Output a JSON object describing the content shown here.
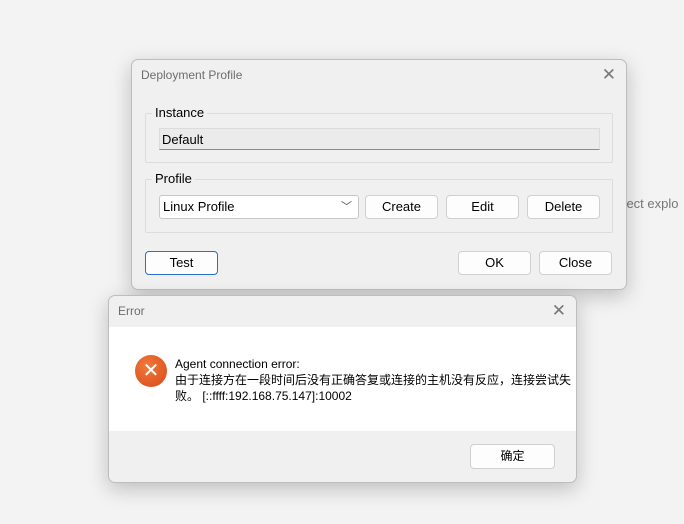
{
  "background": {
    "text": "roject explo"
  },
  "deployment_dialog": {
    "title": "Deployment Profile",
    "instance_label": "Instance",
    "instance_value": "Default",
    "profile_label": "Profile",
    "profile_selected": "Linux Profile",
    "create": "Create",
    "edit": "Edit",
    "delete": "Delete",
    "test": "Test",
    "ok": "OK",
    "close": "Close"
  },
  "error_dialog": {
    "title": "Error",
    "message_line1": "Agent connection error:",
    "message_line2": "由于连接方在一段时间后没有正确答复或连接的主机没有反应，连接尝试失",
    "message_line3": "败。 [::ffff:192.168.75.147]:10002",
    "ok": "确定",
    "icon": "error-icon",
    "icon_color": "#e0501c"
  }
}
